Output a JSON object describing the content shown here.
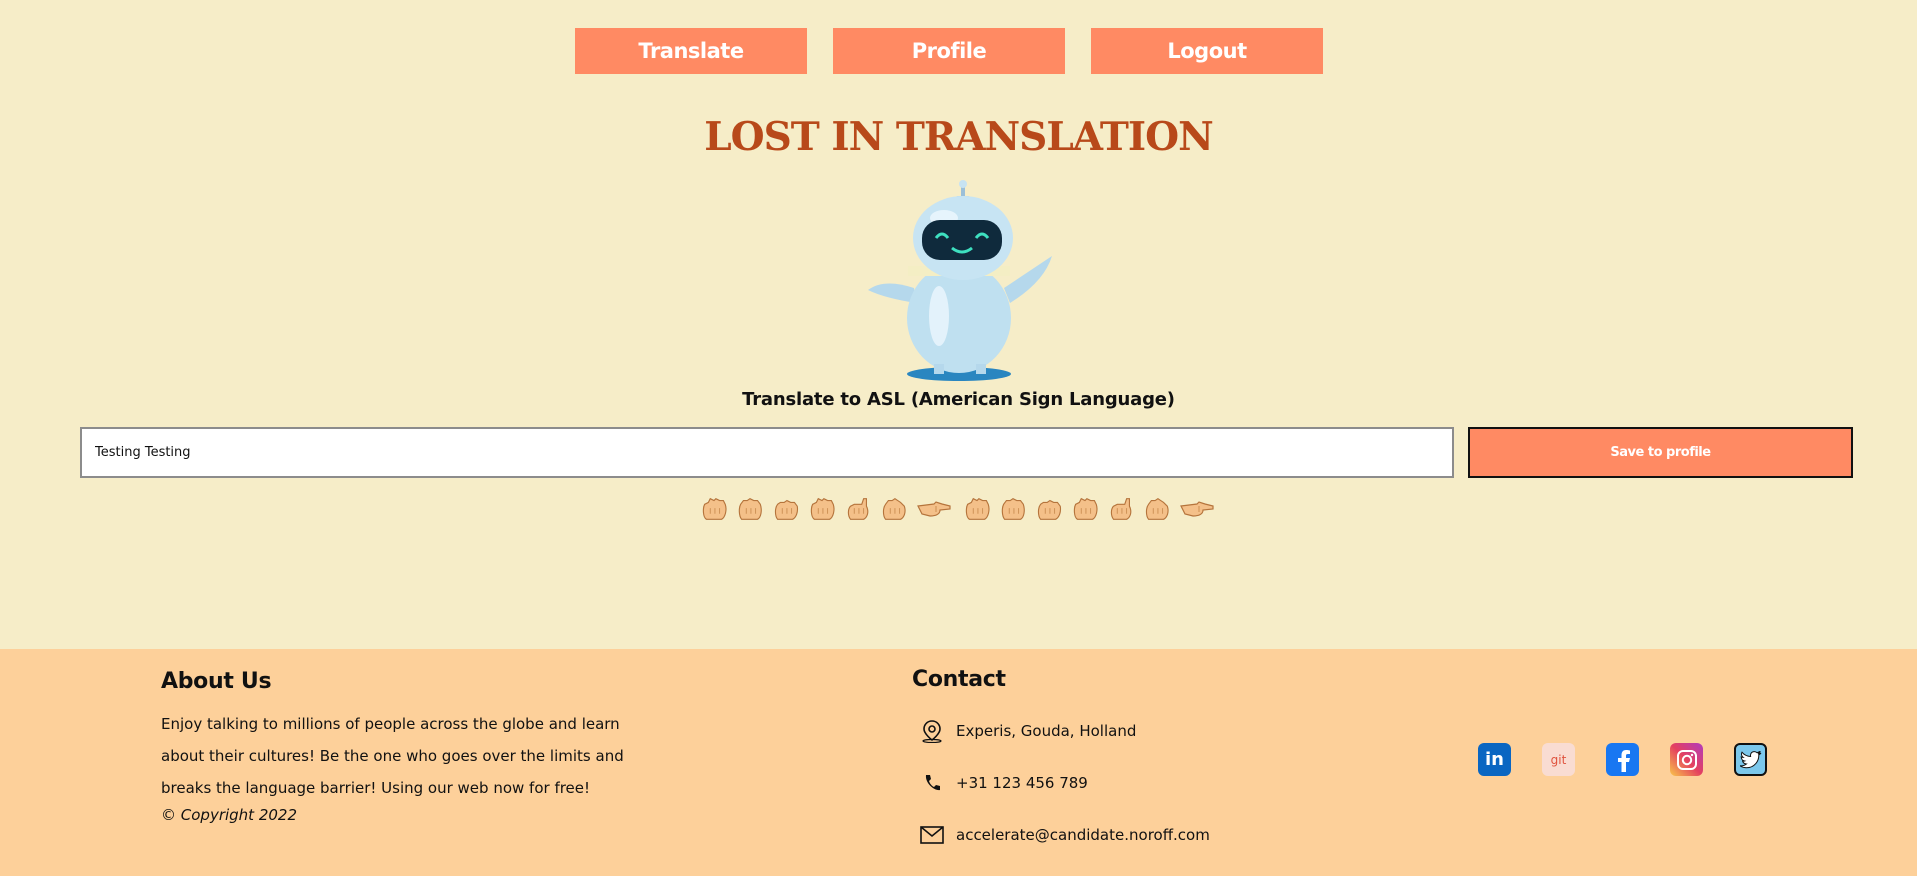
{
  "nav": {
    "translate": "Translate",
    "profile": "Profile",
    "logout": "Logout"
  },
  "header": {
    "title": "LOST IN TRANSLATION",
    "subtitle": "Translate to ASL (American Sign Language)"
  },
  "translator": {
    "input_value": "Testing Testing",
    "save_label": "Save to profile",
    "signs": [
      "T",
      "E",
      "S",
      "T",
      "I",
      "N",
      "G",
      " ",
      "T",
      "E",
      "S",
      "T",
      "I",
      "N",
      "G"
    ]
  },
  "footer": {
    "about_title": "About Us",
    "about_text": "Enjoy talking to millions of people across the globe and learn about their cultures! Be the one who goes over the limits and breaks the language barrier! Using our web now for free!",
    "copyright": "© Copyright 2022",
    "contact_title": "Contact",
    "address": "Experis, Gouda, Holland",
    "phone": "+31 123 456 789",
    "email": "accelerate@candidate.noroff.com",
    "socials": [
      "linkedin-icon",
      "git-icon",
      "facebook-icon",
      "instagram-icon",
      "twitter-icon"
    ],
    "git_text": "git",
    "linkedin_text": "in"
  },
  "colors": {
    "background": "#f6edc8",
    "accent": "#ff8a63",
    "title": "#b8491a",
    "footer": "#fdd09a"
  }
}
